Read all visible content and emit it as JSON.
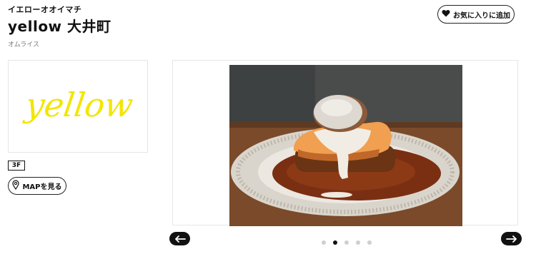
{
  "shop": {
    "kana_name": "イエローオオイマチ",
    "name": "yellow 大井町",
    "category": "オムライス",
    "floor": "3F",
    "logo_text": "yellow"
  },
  "actions": {
    "favorite_label": "お気に入りに追加",
    "map_label": "MAPを見る"
  },
  "carousel": {
    "slide_count": 5,
    "active_index": 1,
    "image_subject": "omurice-on-plate",
    "dots": [
      "",
      "",
      "",
      "",
      ""
    ]
  },
  "colors": {
    "logo_yellow": "#f2e600",
    "text_dark": "#111111",
    "muted": "#777777",
    "border": "#e6e6e6",
    "dot_inactive": "#cfcfcf"
  },
  "icons": {
    "favorite": "heart-icon",
    "map": "map-pin-icon",
    "prev": "arrow-left-icon",
    "next": "arrow-right-icon"
  }
}
